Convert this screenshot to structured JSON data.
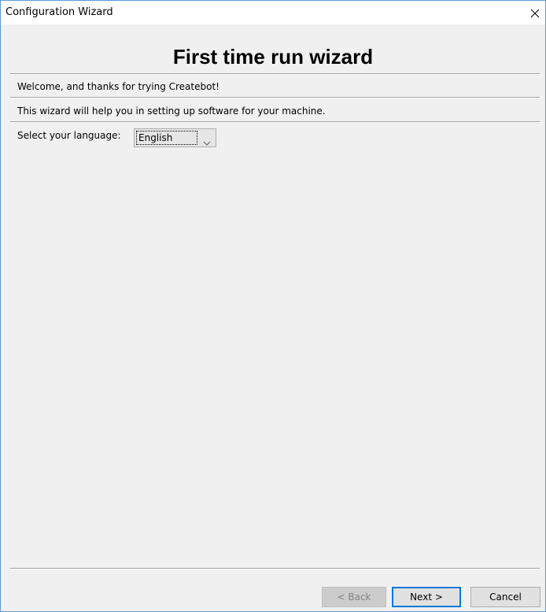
{
  "window": {
    "title": "Configuration Wizard"
  },
  "wizard": {
    "heading": "First time run wizard",
    "welcome_text": "Welcome, and thanks for trying Createbot!",
    "description_text": "This wizard will help you in setting up software for your machine.",
    "language_label": "Select your language:",
    "language_selected": "English"
  },
  "buttons": {
    "back": "< Back",
    "next": "Next >",
    "cancel": "Cancel"
  },
  "colors": {
    "accent": "#0078d7",
    "window_border": "#5a9bd5",
    "background": "#f0f0f0"
  }
}
